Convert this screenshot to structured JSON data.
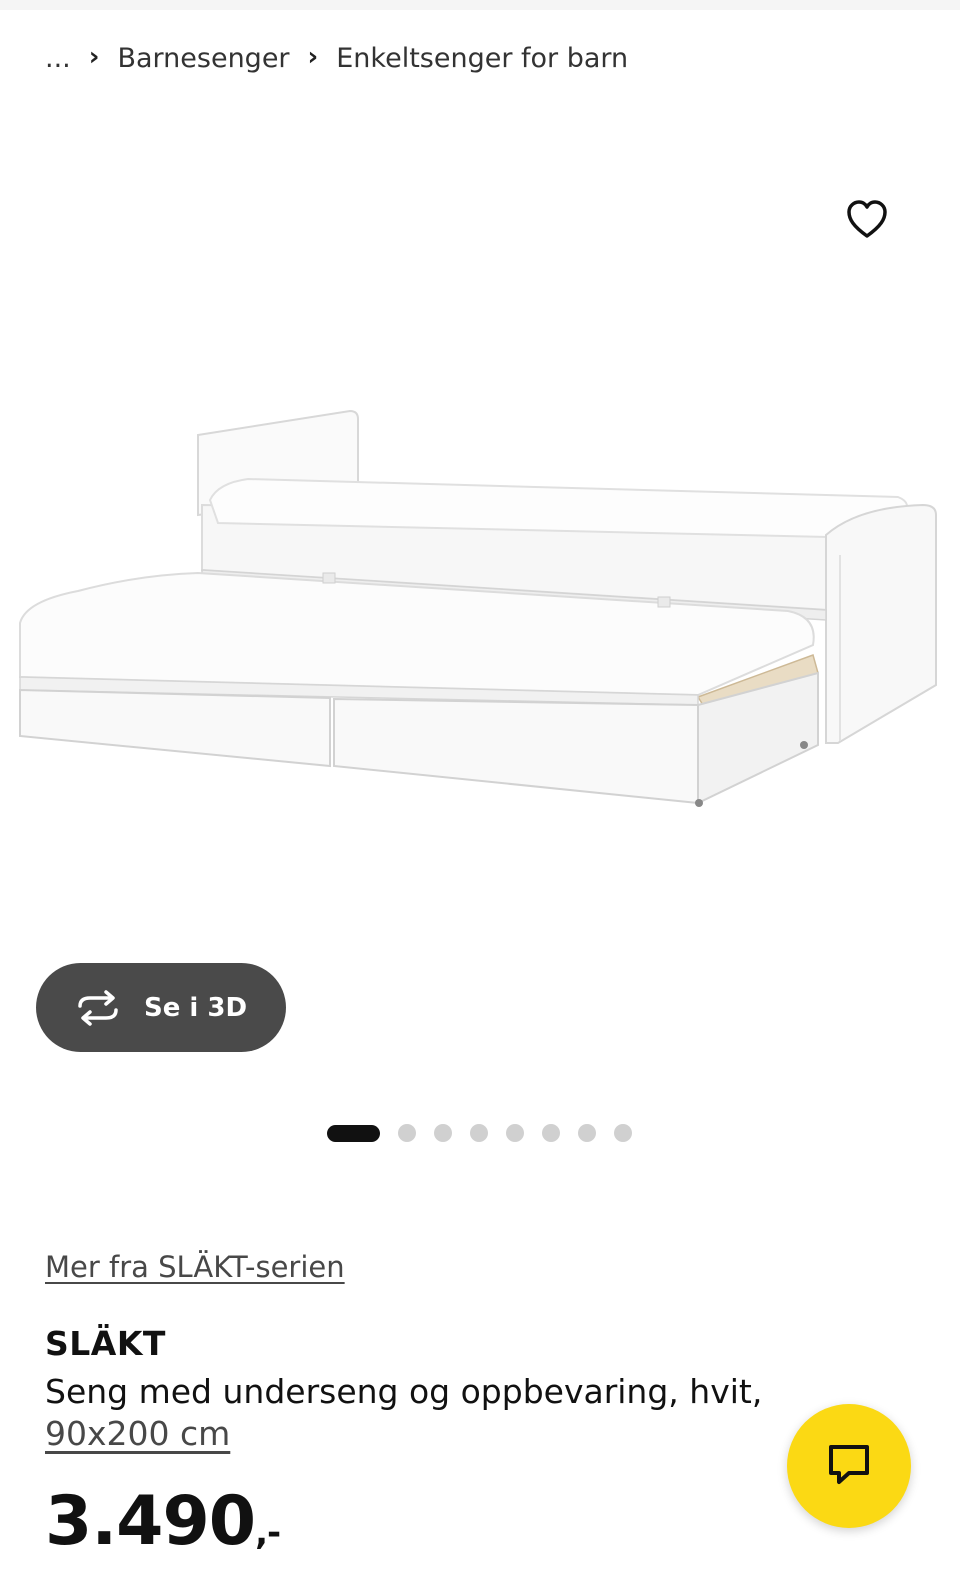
{
  "breadcrumb": {
    "ellipsis": "...",
    "items": [
      "Barnesenger",
      "Enkeltsenger for barn"
    ]
  },
  "view3d": {
    "label": "Se i 3D"
  },
  "carousel": {
    "count": 8,
    "active": 1
  },
  "product": {
    "series_link": "Mer fra SLÄKT-serien",
    "name": "SLÄKT",
    "description": "Seng med underseng og oppbevaring, hvit,",
    "size": "90x200 cm",
    "price": "3.490",
    "price_suffix": ",-"
  },
  "colors": {
    "accent_yellow": "#fbd914",
    "button_dark": "#4a4a4a"
  },
  "icons": [
    "heart-icon",
    "rotate-3d-icon",
    "chat-icon"
  ]
}
